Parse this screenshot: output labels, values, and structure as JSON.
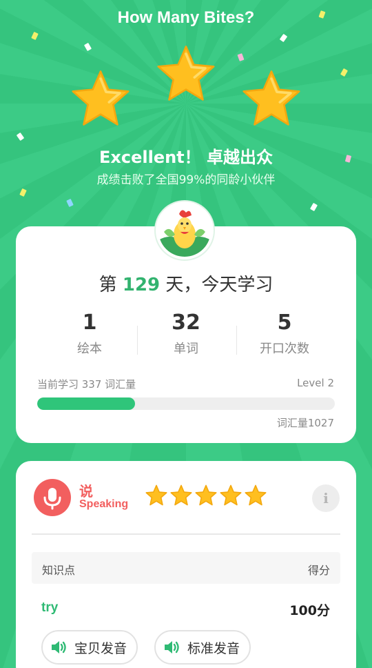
{
  "header": {
    "title": "How Many Bites?",
    "headline": "Excellent！ 卓越出众",
    "subline": "成绩击败了全国99%的同龄小伙伴",
    "stars_earned": 3
  },
  "summary": {
    "day_prefix": "第",
    "day_number": "129",
    "day_suffix": "天，今天学习",
    "stats": [
      {
        "value": "1",
        "label": "绘本"
      },
      {
        "value": "32",
        "label": "单词"
      },
      {
        "value": "5",
        "label": "开口次数"
      }
    ],
    "vocab_label": "当前学习 337 词汇量",
    "level_label": "Level 2",
    "total_label": "词汇量1027",
    "progress_fraction": 0.328
  },
  "speaking": {
    "title_cn": "说",
    "title_en": "Speaking",
    "stars": 5,
    "info_label": "i",
    "table_headers": {
      "left": "知识点",
      "right": "得分"
    },
    "items": [
      {
        "word": "try",
        "score": "100分"
      }
    ],
    "buttons": {
      "baby": "宝贝发音",
      "standard": "标准发音"
    }
  },
  "colors": {
    "background": "#35c47e",
    "accent_green": "#2fba74",
    "speaking_red": "#f25f5f",
    "star_gold": "#ffbf1f"
  }
}
